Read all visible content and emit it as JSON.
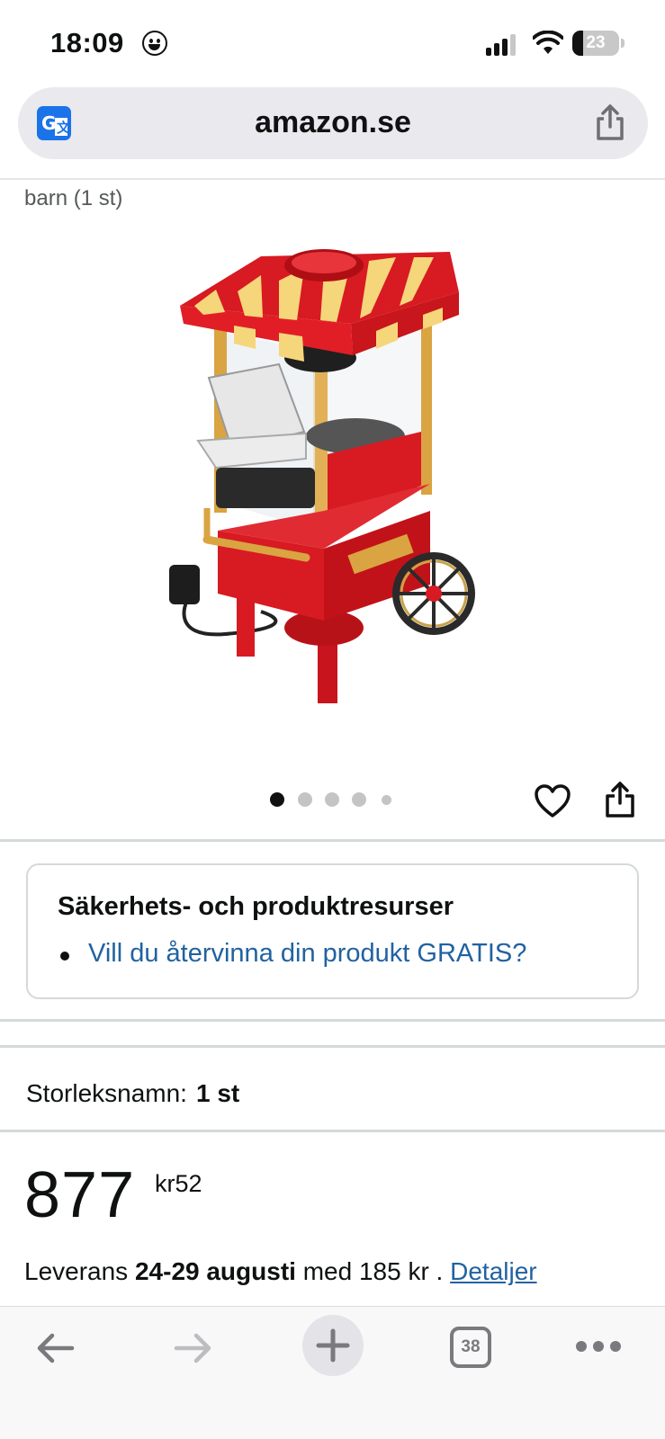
{
  "status_bar": {
    "time": "18:09",
    "battery_percent": "23"
  },
  "browser": {
    "url": "amazon.se",
    "tab_count": "38"
  },
  "product": {
    "title_fragment": "barn (1 st)",
    "image_count": 5,
    "active_image_index": 0
  },
  "safety": {
    "title": "Säkerhets- och produktresurser",
    "link": "Vill du återvinna din produkt GRATIS?"
  },
  "size": {
    "label": "Storleksnamn:",
    "value": "1 st"
  },
  "price": {
    "whole": "877",
    "fraction": "kr52"
  },
  "delivery": {
    "prefix": "Leverans",
    "dates": "24-29 augusti",
    "middle": "med 185 kr .",
    "details_link": "Detaljer"
  },
  "colors": {
    "link": "#2162a1",
    "text": "#0f1111",
    "product_red": "#d81a22",
    "product_gold": "#d9a441"
  },
  "icons": [
    "translate-icon",
    "share-icon",
    "heart-icon",
    "back-arrow-icon",
    "forward-arrow-icon",
    "plus-icon",
    "tabs-icon",
    "more-icon"
  ]
}
